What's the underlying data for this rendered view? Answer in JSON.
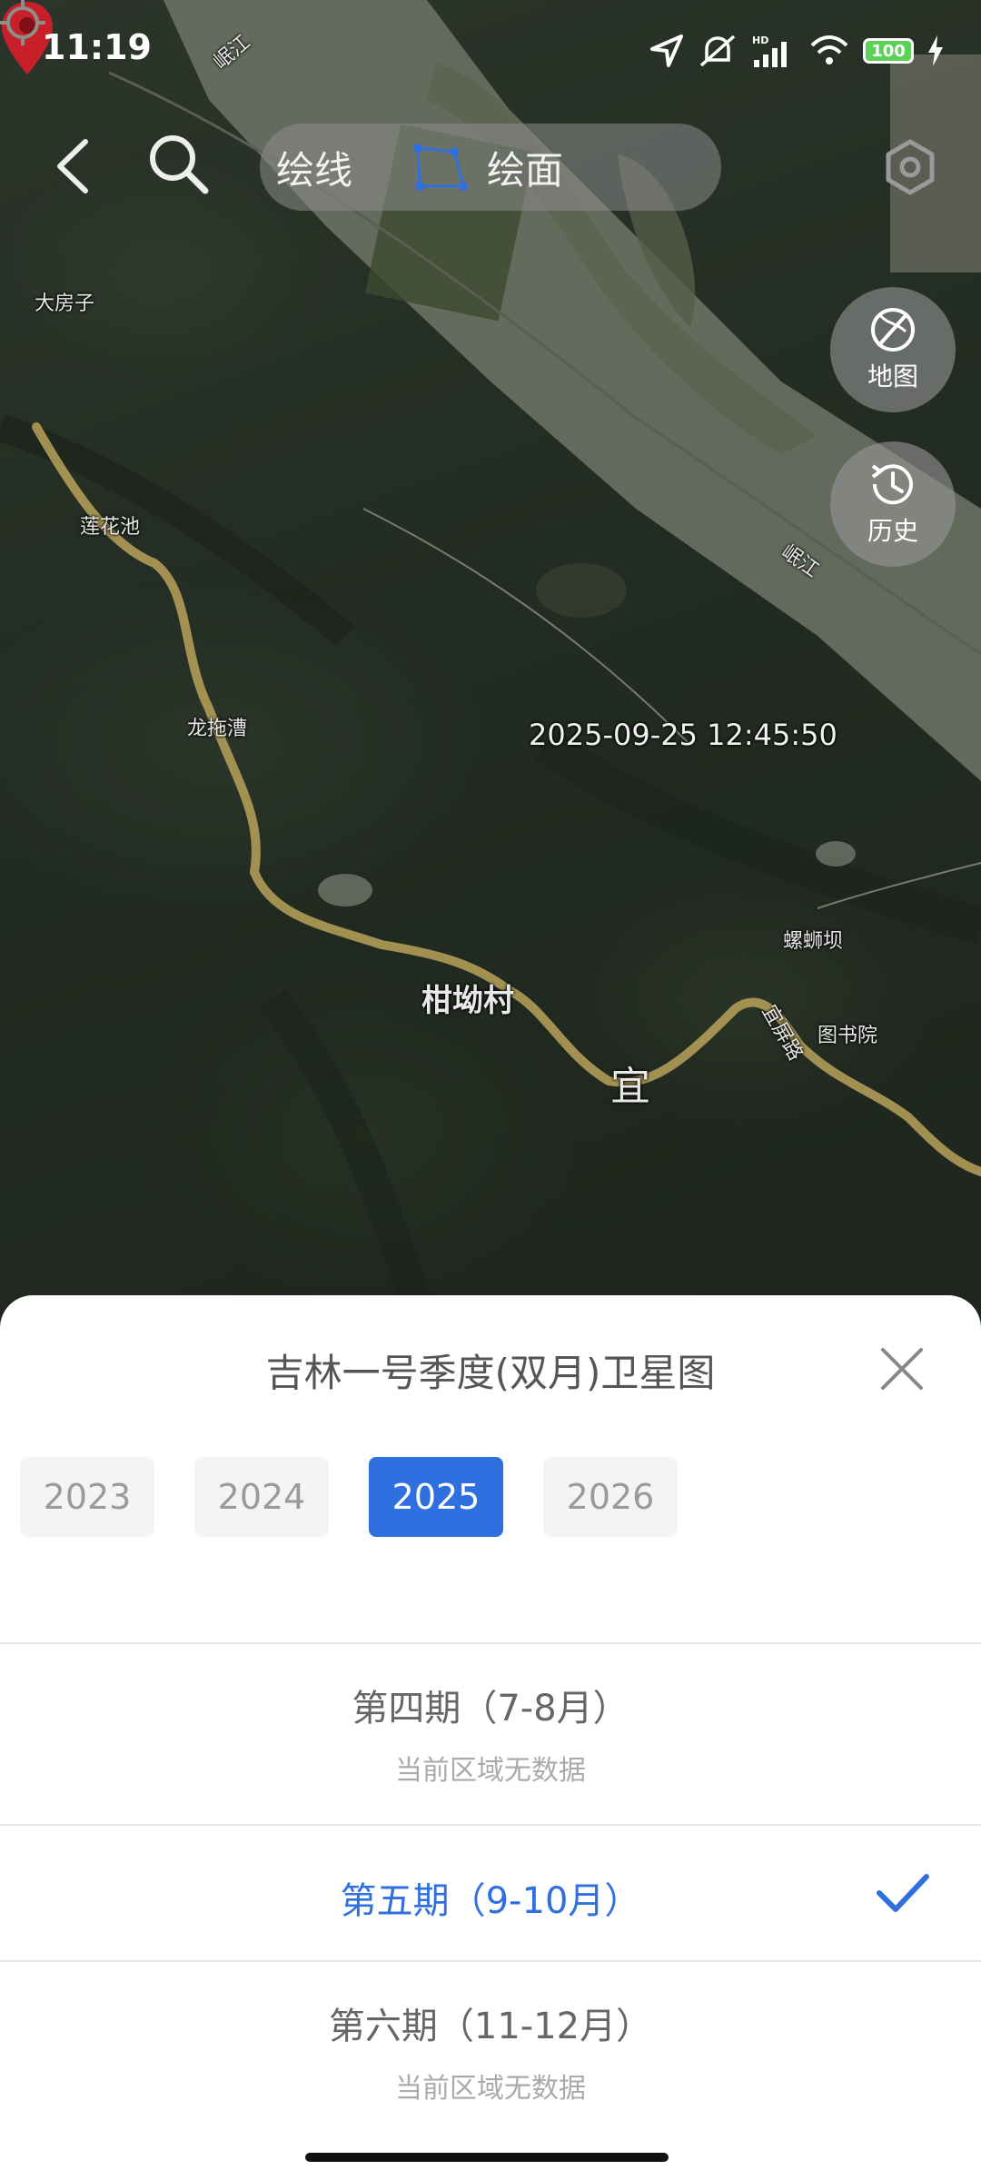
{
  "status_bar": {
    "time": "11:19",
    "battery": "100",
    "network": "HD"
  },
  "toolbar": {
    "draw_line": "绘线",
    "draw_area": "绘面"
  },
  "side_buttons": {
    "map_label": "地图",
    "history_label": "历史"
  },
  "map": {
    "timestamp": "2025-09-25 12:45:50",
    "labels": {
      "river_top": "岷江",
      "river_right": "岷江",
      "dafangzi": "大房子",
      "lianhuachi": "莲花池",
      "longtuocao": "龙拖漕",
      "village": "柑坳村",
      "luoshiba": "螺蛳坝",
      "tushuyuan": "图书院",
      "road": "宜屏路",
      "road_big": "宜"
    }
  },
  "sheet": {
    "title": "吉林一号季度(双月)卫星图",
    "years": [
      "2023",
      "2024",
      "2025",
      "2026"
    ],
    "selected_year": "2025",
    "periods": [
      {
        "name": "第四期（7-8月）",
        "sub": "当前区域无数据",
        "selected": false
      },
      {
        "name": "第五期（9-10月）",
        "sub": "",
        "selected": true
      },
      {
        "name": "第六期（11-12月）",
        "sub": "当前区域无数据",
        "selected": false
      }
    ]
  },
  "colors": {
    "accent": "#2f6fe0",
    "pin": "#c8202a",
    "road": "#b9a25a",
    "river": "#6e7565"
  }
}
